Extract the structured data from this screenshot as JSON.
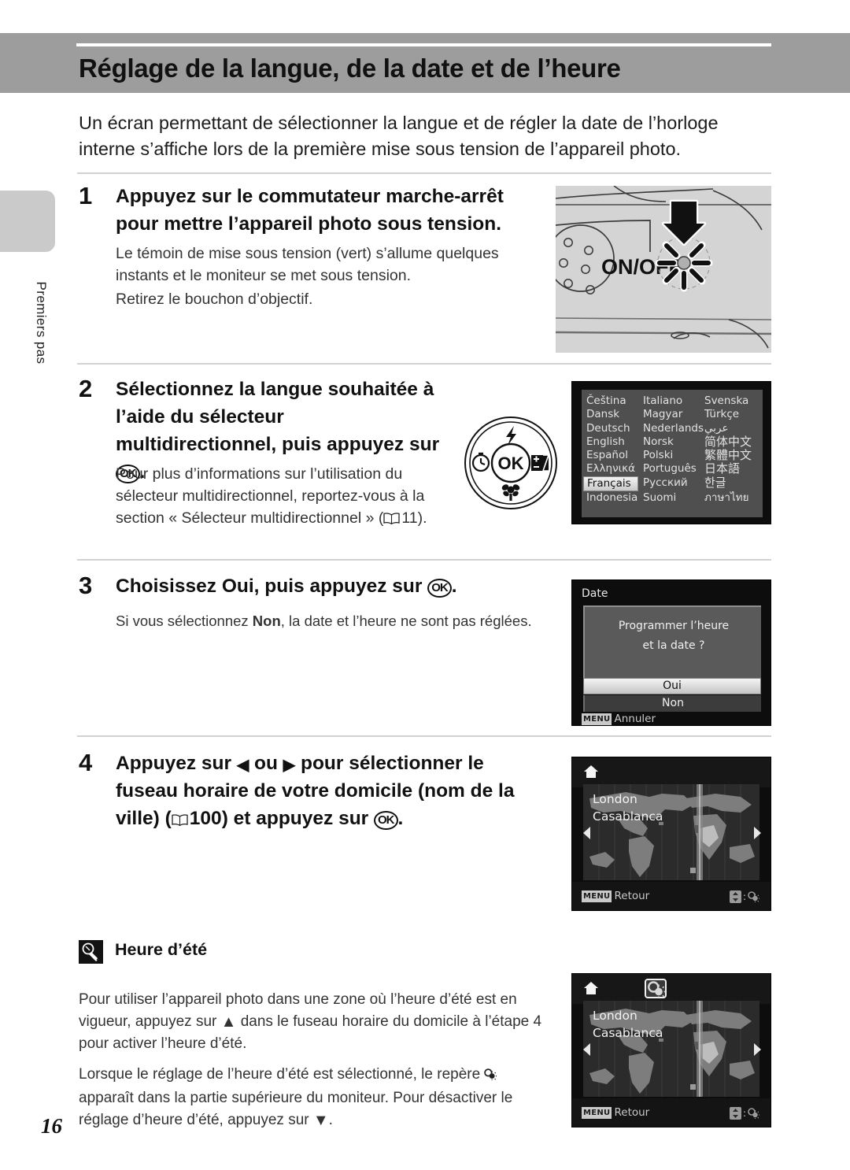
{
  "header": {
    "title": "Réglage de la langue, de la date et de l’heure"
  },
  "sidebar": {
    "tab_label": "Premiers pas"
  },
  "intro": "Un écran permettant de sélectionner la langue et de régler la date de l’horloge interne s’affiche lors de la première mise sous tension de l’appareil photo.",
  "steps": [
    {
      "number": "1",
      "heading": "Appuyez sur le commutateur marche-arrêt pour mettre l’appareil photo sous tension.",
      "body_1": "Le témoin de mise sous tension (vert) s’allume quelques instants et le moniteur se met sous tension.",
      "body_2": "Retirez le bouchon d’objectif.",
      "illustration_label": "ON/OFF"
    },
    {
      "number": "2",
      "heading_pre": "Sélectionnez la langue souhaitée à l’aide du sélecteur multidirectionnel, puis appuyez sur ",
      "heading_ok": "OK",
      "heading_post": ".",
      "body_pre": "Pour plus d’informations sur l’utilisation du sélecteur multidirectionnel, reportez-vous à la section « Sélecteur multidirectionnel » (",
      "body_ref": "11",
      "body_post": ")."
    },
    {
      "number": "3",
      "heading_pre": "Choisissez ",
      "heading_bold": "Oui",
      "heading_mid": ", puis appuyez sur ",
      "heading_ok": "OK",
      "heading_post": ".",
      "body_pre": "Si vous sélectionnez ",
      "body_bold": "Non",
      "body_post": ", la date et l’heure ne sont pas réglées."
    },
    {
      "number": "4",
      "heading_a": "Appuyez sur ",
      "heading_left": "◀",
      "heading_b": " ou ",
      "heading_right": "▶",
      "heading_c": " pour sélectionner le fuseau horaire de votre domicile (nom de la ville) (",
      "heading_ref": "100",
      "heading_d": ") et appuyez sur ",
      "heading_ok": "OK",
      "heading_e": "."
    }
  ],
  "language_screen": {
    "languages": [
      "Čeština",
      "Italiano",
      "Svenska",
      "Dansk",
      "Magyar",
      "Türkçe",
      "Deutsch",
      "Nederlands",
      "عربي",
      "English",
      "Norsk",
      "简体中文",
      "Español",
      "Polski",
      "繁體中文",
      "Ελληνικά",
      "Português",
      "日本語",
      "Français",
      "Русский",
      "한글",
      "Indonesia",
      "Suomi",
      "ภาษาไทย"
    ],
    "selected": "Français"
  },
  "date_screen": {
    "title": "Date",
    "message_line1": "Programmer l’heure",
    "message_line2": "et la date ?",
    "yes_label": "Oui",
    "no_label": "Non",
    "menu_chip": "MENU",
    "menu_action": "Annuler"
  },
  "map_screen_1": {
    "city_primary": "London",
    "city_secondary": "Casablanca",
    "menu_chip": "MENU",
    "menu_action": "Retour",
    "dst_hint_separator": ":",
    "dst_enabled": false
  },
  "map_screen_2": {
    "city_primary": "London",
    "city_secondary": "Casablanca",
    "menu_chip": "MENU",
    "menu_action": "Retour",
    "dst_hint_separator": ":",
    "dst_enabled": true
  },
  "note": {
    "title": "Heure d’été",
    "paragraph_1_a": "Pour utiliser l’appareil photo dans une zone où l’heure d’été est en vigueur, appuyez sur ",
    "paragraph_1_arrow": "▲",
    "paragraph_1_b": " dans le fuseau horaire du domicile à l’étape 4 pour activer l’heure d’été.",
    "paragraph_2_a": "Lorsque le réglage de l’heure d’été est sélectionné, le repère ",
    "paragraph_2_b": " apparaît dans la partie supérieure du moniteur. Pour désactiver le réglage d’heure d’été, appuyez sur ",
    "paragraph_2_arrow": "▼",
    "paragraph_2_c": "."
  },
  "footer": {
    "page_number": "16"
  },
  "colors": {
    "header_band": "#9d9d9d",
    "side_tab": "#cacaca",
    "rule": "#d2d2d2",
    "lcd_background": "#0d0d0d"
  }
}
